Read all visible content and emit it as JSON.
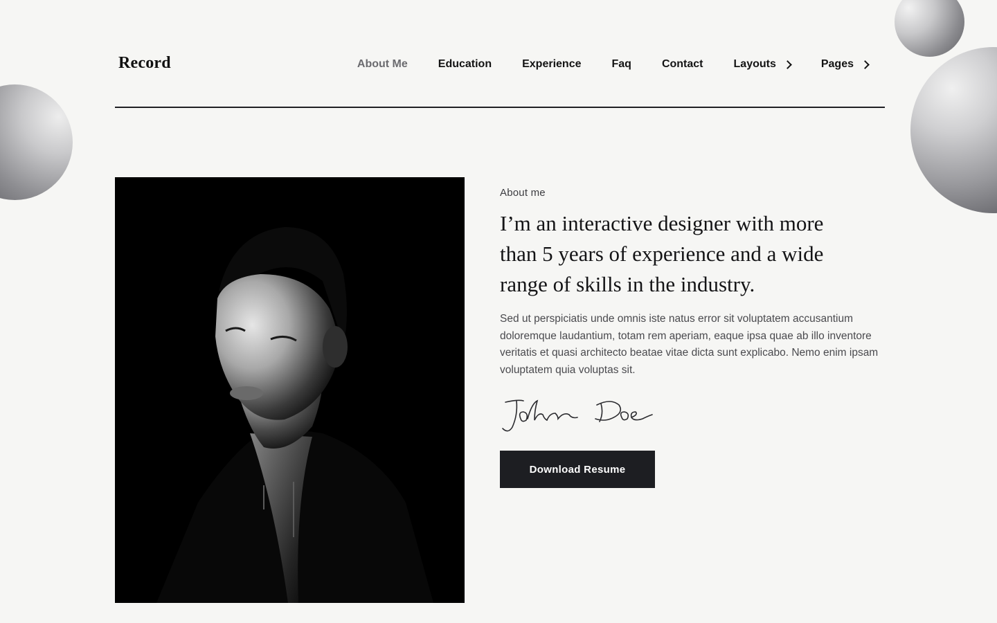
{
  "brand": {
    "logo": "Record"
  },
  "nav": {
    "items": [
      {
        "label": "About Me",
        "active": true,
        "has_submenu": false
      },
      {
        "label": "Education",
        "active": false,
        "has_submenu": false
      },
      {
        "label": "Experience",
        "active": false,
        "has_submenu": false
      },
      {
        "label": "Faq",
        "active": false,
        "has_submenu": false
      },
      {
        "label": "Contact",
        "active": false,
        "has_submenu": false
      },
      {
        "label": "Layouts",
        "active": false,
        "has_submenu": true
      },
      {
        "label": "Pages",
        "active": false,
        "has_submenu": true
      }
    ]
  },
  "about": {
    "eyebrow": "About me",
    "headline": "I’m an interactive designer with more than 5 years of experience and a wide range of skills in the industry.",
    "body": "Sed ut perspiciatis unde omnis iste natus error sit voluptatem accusantium doloremque laudantium, totam rem aperiam, eaque ipsa quae ab illo inventore veritatis et quasi architecto beatae vitae dicta sunt explicabo. Nemo enim ipsam voluptatem quia voluptas sit.",
    "signature": "John Doe",
    "button_label": "Download Resume"
  },
  "icons": {
    "submenu": "chevron-right-icon"
  },
  "colors": {
    "background": "#f6f6f4",
    "text_primary": "#141414",
    "nav_active": "#6b6b6f",
    "button_bg": "#1d1e22",
    "button_text": "#ffffff",
    "divider": "#1f1f23"
  }
}
